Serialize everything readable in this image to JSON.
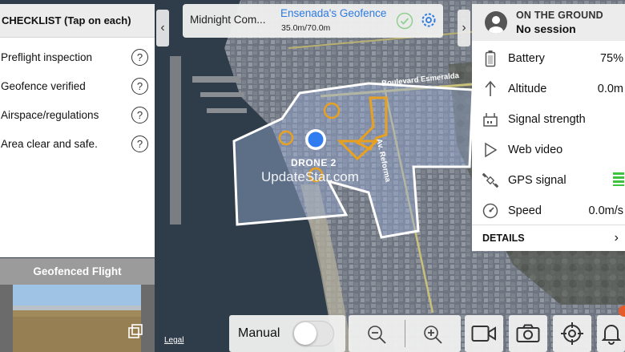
{
  "checklist": {
    "title": "CHECKLIST (Tap on each)",
    "items": [
      {
        "label": "Preflight inspection"
      },
      {
        "label": "Geofence verified"
      },
      {
        "label": "Airspace/regulations"
      },
      {
        "label": "Area clear and safe."
      }
    ],
    "help_symbol": "?"
  },
  "preview": {
    "title": "Geofenced Flight"
  },
  "mission": {
    "name": "Midnight Com...",
    "geofence_name": "Ensenada's Geofence",
    "geofence_dims": "35.0m/70.0m"
  },
  "status": {
    "location_label": "ON THE GROUND",
    "session": "No session",
    "rows": [
      {
        "icon": "battery-icon",
        "label": "Battery",
        "value": "75%"
      },
      {
        "icon": "altitude-icon",
        "label": "Altitude",
        "value": "0.0m"
      },
      {
        "icon": "signal-strength-icon",
        "label": "Signal strength",
        "value": ""
      },
      {
        "icon": "play-icon",
        "label": "Web video",
        "value": ""
      },
      {
        "icon": "satellite-icon",
        "label": "GPS signal",
        "value": ""
      },
      {
        "icon": "speedometer-icon",
        "label": "Speed",
        "value": "0.0m/s"
      }
    ],
    "details_label": "DETAILS",
    "details_chevron": "›"
  },
  "map": {
    "drone_label": "DRONE 2",
    "legal": "Legal",
    "watermark": "UpdateStar.com",
    "streets": [
      "Boulevard Esmeralda",
      "Av. Reforma"
    ]
  },
  "toolbar": {
    "manual_label": "Manual",
    "manual_on": false
  },
  "nav": {
    "left_arrow": "‹",
    "right_arrow": "›"
  },
  "colors": {
    "accent_blue": "#2d7be0",
    "geofence_orange": "#e8a020",
    "gps_green": "#3cc43c",
    "drone_blue": "#2f7df0",
    "badge_orange": "#e45a2a"
  }
}
